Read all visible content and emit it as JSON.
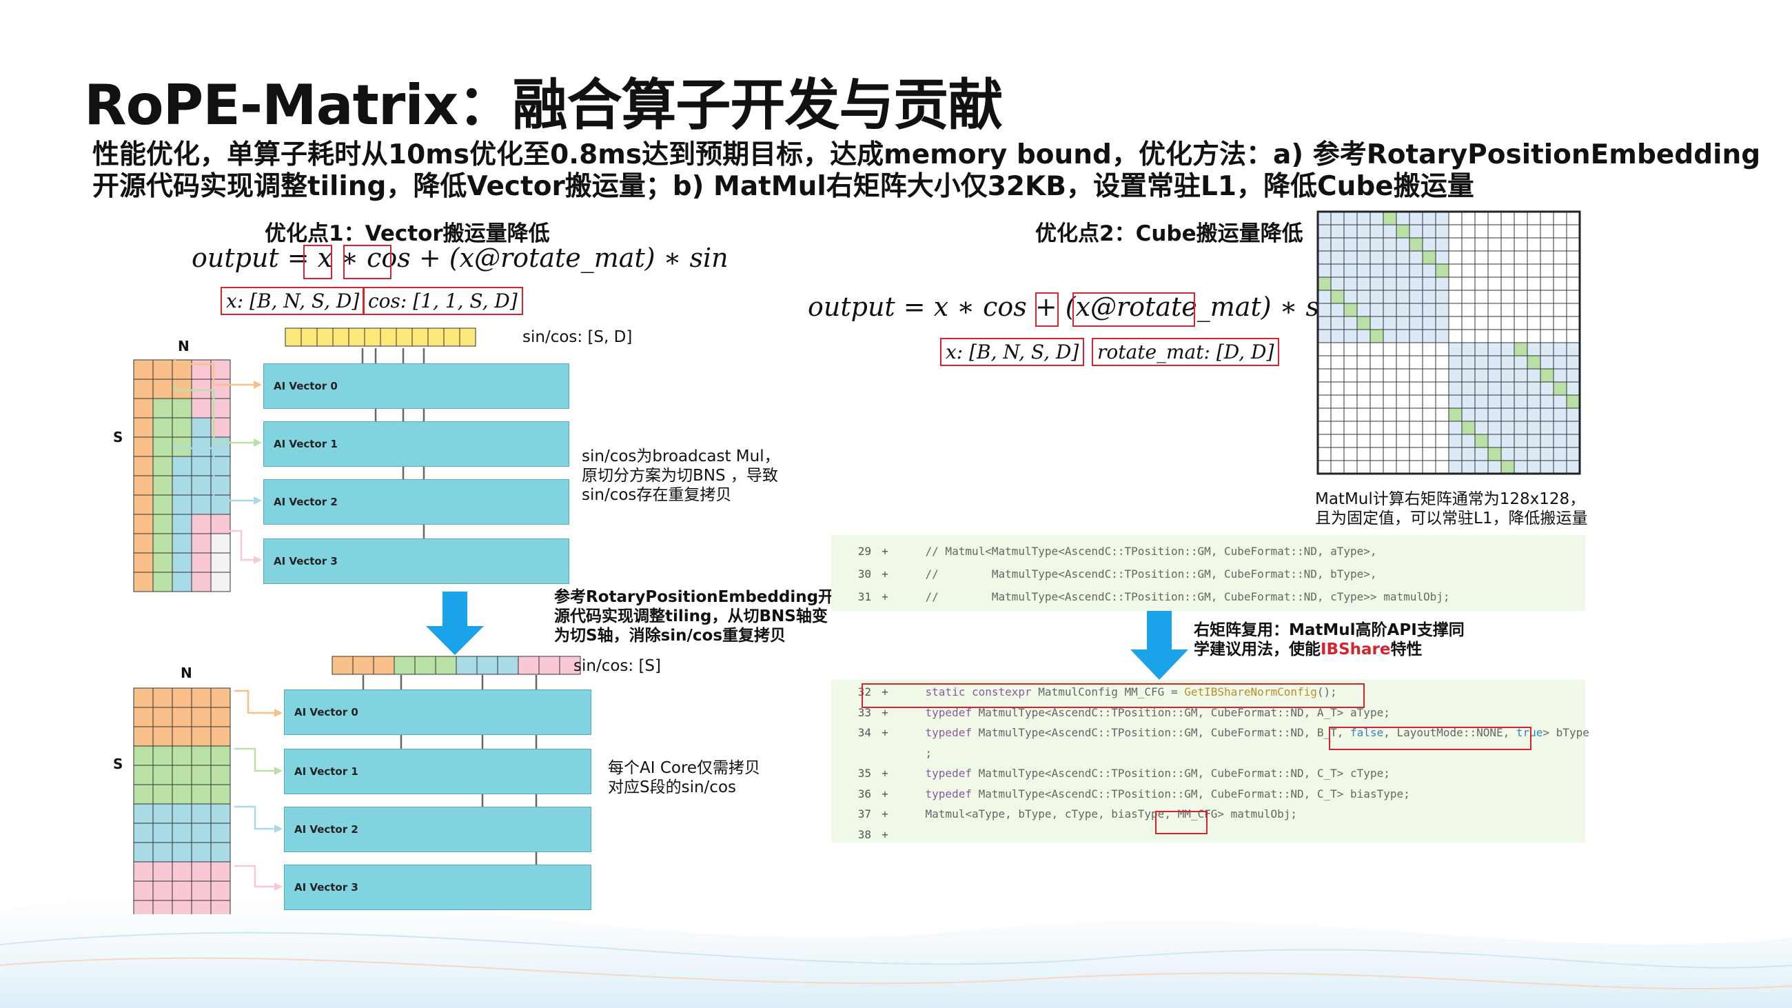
{
  "title": "RoPE-Matrix：融合算子开发与贡献",
  "intro": "性能优化，单算子耗时从10ms优化至0.8ms达到预期目标，达成memory bound，优化方法：a) 参考RotaryPositionEmbedding开源代码实现调整tiling，降低Vector搬运量；b) MatMul右矩阵大小仅32KB，设置常驻L1，降低Cube搬运量",
  "left": {
    "section_title": "优化点1：Vector搬运量降低",
    "formula": "output = x ∗ cos + (x@rotate_mat) ∗ sin",
    "shape_x": "x: [B, N, S, D]",
    "shape_cos": "cos: [1, 1, S, D]",
    "diagram1": {
      "n_label": "N",
      "s_label": "S",
      "sincos_label": "sin/cos: [S, D]",
      "vectors": [
        "AI Vector 0",
        "AI Vector 1",
        "AI Vector 2",
        "AI Vector 3"
      ],
      "note": [
        "sin/cos为broadcast Mul，",
        "原切分方案为切BNS ，导致",
        "sin/cos存在重复拷贝"
      ]
    },
    "arrow_note": [
      "参考RotaryPositionEmbedding开",
      "源代码实现调整tiling，从切BNS轴变",
      "为切S轴，消除sin/cos重复拷贝"
    ],
    "diagram2": {
      "n_label": "N",
      "s_label": "S",
      "sincos_label": "sin/cos: [S]",
      "vectors": [
        "AI Vector 0",
        "AI Vector 1",
        "AI Vector 2",
        "AI Vector 3"
      ],
      "note": [
        "每个AI Core仅需拷贝",
        "对应S段的sin/cos"
      ]
    }
  },
  "right": {
    "section_title": "优化点2：Cube搬运量降低",
    "formula": "output = x ∗ cos + (x@rotate_mat) ∗ sin",
    "shape_x": "x: [B, N, S, D]",
    "shape_rot": "rotate_mat: [D, D]",
    "matrix_caption": [
      "MatMul计算右矩阵通常为128x128，",
      "且为固定值，可以常驻L1，降低搬运量"
    ],
    "code1": [
      {
        "ln": "29",
        "pl": "+",
        "text": "    // Matmul<MatmulType<AscendC::TPosition::GM, CubeFormat::ND, aType>,"
      },
      {
        "ln": "30",
        "pl": "+",
        "text": "    //        MatmulType<AscendC::TPosition::GM, CubeFormat::ND, bType>,"
      },
      {
        "ln": "31",
        "pl": "+",
        "text": "    //        MatmulType<AscendC::TPosition::GM, CubeFormat::ND, cType>> matmulObj;"
      }
    ],
    "arrow_note_pre": "右矩阵复用：MatMul高阶API支撑同",
    "arrow_note_line2_pre": "学建议用法，使能",
    "arrow_note_highlight": "IBShare",
    "arrow_note_post": "特性",
    "code2": [
      {
        "ln": "32",
        "pl": "+",
        "html": "<span class=\"kw\">static constexpr</span> MatmulConfig MM_CFG = <span class=\"fn\">GetIBShareNormConfig</span>();"
      },
      {
        "ln": "33",
        "pl": "+",
        "html": "<span class=\"kw\">typedef</span> MatmulType&lt;AscendC::TPosition::GM, CubeFormat::ND, A_T&gt; aType;"
      },
      {
        "ln": "34",
        "pl": "+",
        "html": "<span class=\"kw\">typedef</span> MatmulType&lt;AscendC::TPosition::GM, CubeFormat::ND, B_T, <span class=\"hl\">false</span>, LayoutMode::NONE, <span class=\"hl\">true</span>&gt; bType"
      },
      {
        "ln": "",
        "pl": "",
        "html": ";"
      },
      {
        "ln": "35",
        "pl": "+",
        "html": "<span class=\"kw\">typedef</span> MatmulType&lt;AscendC::TPosition::GM, CubeFormat::ND, C_T&gt; cType;"
      },
      {
        "ln": "36",
        "pl": "+",
        "html": "<span class=\"kw\">typedef</span> MatmulType&lt;AscendC::TPosition::GM, CubeFormat::ND, C_T&gt; biasType;"
      },
      {
        "ln": "37",
        "pl": "+",
        "html": "Matmul&lt;aType, bType, cType, biasType, MM_CFG&gt; matmulObj;"
      },
      {
        "ln": "38",
        "pl": "+",
        "html": ""
      }
    ]
  },
  "colors": {
    "orange": "#f9c08a",
    "green": "#b9e0a5",
    "blue": "#a9dbe6",
    "pink": "#f8c9d4",
    "yellow": "#fde97a",
    "vector": "#82d3e0",
    "red": "#d6242f",
    "arrow": "#1aa3e8"
  }
}
